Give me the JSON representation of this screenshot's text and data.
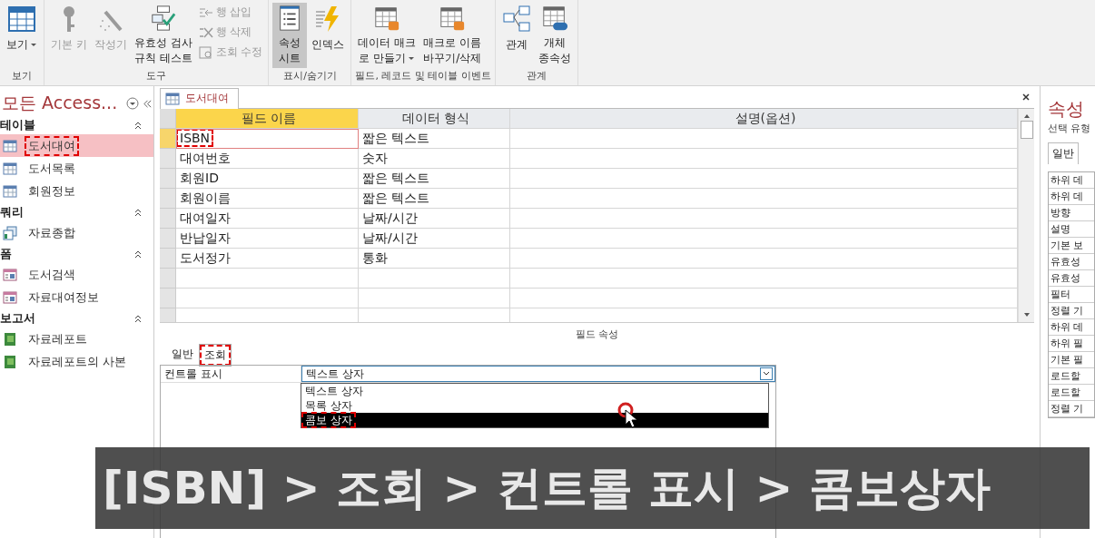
{
  "ribbon": {
    "groups": [
      {
        "label": "보기",
        "buttons": [
          {
            "kind": "view",
            "label": "보기",
            "dropdown": true,
            "disabled": false,
            "selected": false
          }
        ]
      },
      {
        "label": "도구",
        "buttons": [
          {
            "kind": "key",
            "label": "기본 키",
            "dropdown": false,
            "disabled": true,
            "selected": false
          },
          {
            "kind": "builder",
            "label": "작성기",
            "dropdown": false,
            "disabled": true,
            "selected": false
          },
          {
            "kind": "validate",
            "label": "유효성 검사\n규칙 테스트",
            "dropdown": false,
            "disabled": false,
            "selected": false
          }
        ],
        "small": [
          {
            "kind": "insert-row",
            "label": "행 삽입",
            "disabled": true
          },
          {
            "kind": "delete-row",
            "label": "행 삭제",
            "disabled": true
          },
          {
            "kind": "lookup",
            "label": "조회 수정",
            "disabled": true
          }
        ]
      },
      {
        "label": "표시/숨기기",
        "buttons": [
          {
            "kind": "sheet",
            "label": "속성\n시트",
            "dropdown": false,
            "disabled": false,
            "selected": true
          },
          {
            "kind": "index",
            "label": "인덱스",
            "dropdown": false,
            "disabled": false,
            "selected": false
          }
        ]
      },
      {
        "label": "필드, 레코드 및 테이블 이벤트",
        "buttons": [
          {
            "kind": "macro",
            "label": "데이터 매크\n로 만들기",
            "dropdown": true,
            "disabled": false,
            "selected": false
          },
          {
            "kind": "macro-rename",
            "label": "매크로 이름\n바꾸기/삭제",
            "dropdown": false,
            "disabled": false,
            "selected": false
          }
        ]
      },
      {
        "label": "관계",
        "buttons": [
          {
            "kind": "relations",
            "label": "관계",
            "dropdown": false,
            "disabled": false,
            "selected": false
          },
          {
            "kind": "dependency",
            "label": "개체\n종속성",
            "dropdown": false,
            "disabled": false,
            "selected": false
          }
        ]
      }
    ]
  },
  "nav": {
    "title": "모든 Access...",
    "groups": [
      {
        "label": "테이블",
        "expanded": true,
        "items": [
          {
            "kind": "table",
            "label": "도서대여",
            "selected": true,
            "annotated": true
          },
          {
            "kind": "table",
            "label": "도서목록",
            "selected": false,
            "annotated": false
          },
          {
            "kind": "table",
            "label": "회원정보",
            "selected": false,
            "annotated": false
          }
        ]
      },
      {
        "label": "쿼리",
        "expanded": true,
        "items": [
          {
            "kind": "query",
            "label": "자료종합",
            "selected": false,
            "annotated": false
          }
        ]
      },
      {
        "label": "폼",
        "expanded": true,
        "items": [
          {
            "kind": "form",
            "label": "도서검색",
            "selected": false,
            "annotated": false
          },
          {
            "kind": "form",
            "label": "자료대여정보",
            "selected": false,
            "annotated": false
          }
        ]
      },
      {
        "label": "보고서",
        "expanded": true,
        "items": [
          {
            "kind": "report",
            "label": "자료레포트",
            "selected": false,
            "annotated": false
          },
          {
            "kind": "report",
            "label": "자료레포트의 사본",
            "selected": false,
            "annotated": false
          }
        ]
      }
    ]
  },
  "document_tab": {
    "label": "도서대여"
  },
  "table": {
    "columns": [
      {
        "label": "필드 이름",
        "selected": true
      },
      {
        "label": "데이터 형식",
        "selected": false
      },
      {
        "label": "설명(옵션)",
        "selected": false
      }
    ],
    "rows": [
      {
        "field": "ISBN",
        "type": "짧은 텍스트",
        "selected": true,
        "annotated": true
      },
      {
        "field": "대여번호",
        "type": "숫자",
        "selected": false,
        "annotated": false
      },
      {
        "field": "회원ID",
        "type": "짧은 텍스트",
        "selected": false,
        "annotated": false
      },
      {
        "field": "회원이름",
        "type": "짧은 텍스트",
        "selected": false,
        "annotated": false
      },
      {
        "field": "대여일자",
        "type": "날짜/시간",
        "selected": false,
        "annotated": false
      },
      {
        "field": "반납일자",
        "type": "날짜/시간",
        "selected": false,
        "annotated": false
      },
      {
        "field": "도서정가",
        "type": "통화",
        "selected": false,
        "annotated": false
      }
    ]
  },
  "field_properties": {
    "title": "필드 속성",
    "tabs": [
      {
        "label": "일반",
        "selected": false,
        "annotated": false
      },
      {
        "label": "조회",
        "selected": true,
        "annotated": true
      }
    ],
    "property": {
      "label": "컨트롤 표시",
      "value": "텍스트 상자"
    },
    "options": [
      {
        "label": "텍스트 상자",
        "selected": false,
        "annotated": false
      },
      {
        "label": "목록 상자",
        "selected": false,
        "annotated": false
      },
      {
        "label": "콤보 상자",
        "selected": true,
        "annotated": true
      }
    ]
  },
  "property_sheet": {
    "title": "속성",
    "subtitle": "선택 유형",
    "tab": "일반",
    "rows": [
      "하위 데",
      "하위 데",
      "방향",
      "설명",
      "기본 보",
      "유효성",
      "유효성",
      "필터",
      "정렬 기",
      "하위 데",
      "하위 필",
      "기본 필",
      "로드할",
      "로드할",
      "정렬 기"
    ]
  },
  "caption": "[ISBN] > 조회 >  컨트롤 표시 > 콤보상자"
}
